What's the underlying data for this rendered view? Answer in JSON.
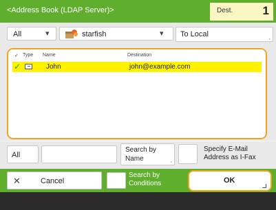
{
  "title": "<Address Book (LDAP Server)>",
  "destination": {
    "label": "Dest.",
    "count": "1"
  },
  "filter": {
    "selected": "All",
    "server": "starfish",
    "to_local_label": "To Local"
  },
  "list": {
    "columns": [
      "Type",
      "Name",
      "Destination"
    ],
    "rows": [
      {
        "selected": true,
        "name": "John",
        "destination": "john@example.com"
      }
    ]
  },
  "search": {
    "all_label": "All",
    "search_by_name_line1": "Search by",
    "search_by_name_line2": "Name",
    "ifax_line1": "Specify E-Mail",
    "ifax_line2": "Address as I-Fax"
  },
  "footer_buttons": {
    "cancel_label": "Cancel",
    "conditions_line1": "Search by",
    "conditions_line2": "Conditions",
    "ok_label": "OK"
  },
  "colors": {
    "accent": "#5fae2e",
    "highlight": "#fff200",
    "focus": "#f5a31f",
    "dest_bg": "#fbf7c2"
  },
  "icons": [
    "check-icon",
    "mail-icon",
    "server-icon",
    "chevron-down-icon",
    "close-icon"
  ]
}
